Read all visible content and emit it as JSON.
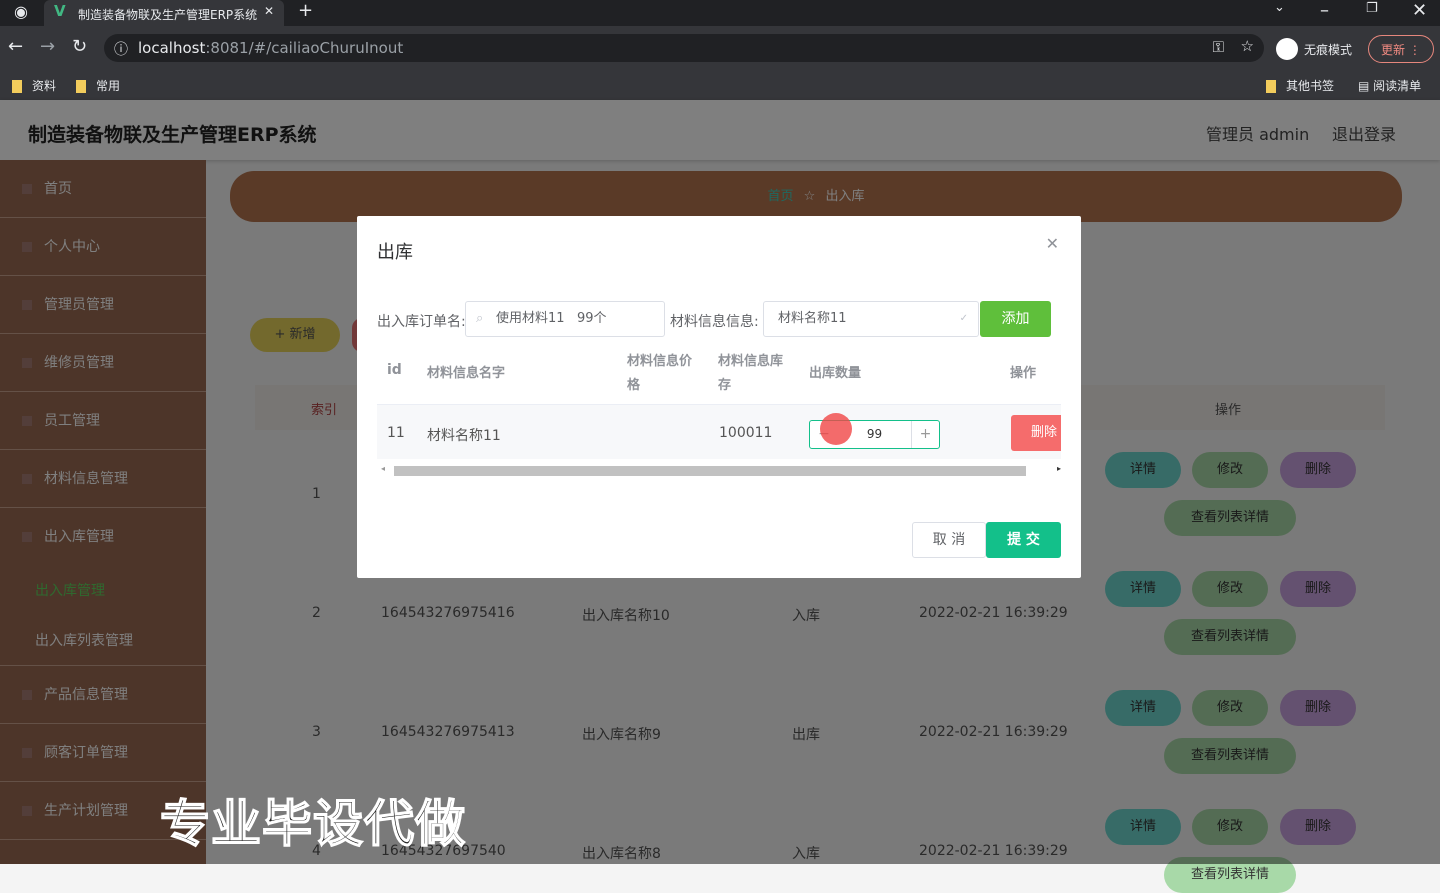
{
  "browser": {
    "tab_title": "制造装备物联及生产管理ERP系统",
    "url_host": "localhost",
    "url_path": ":8081/#/cailiaoChuruInout",
    "incognito": "无痕模式",
    "update": "更新",
    "bookmarks": [
      "资料",
      "常用"
    ],
    "other_bookmarks": "其他书签",
    "reading_list": "阅读清单"
  },
  "header": {
    "title": "制造装备物联及生产管理ERP系统",
    "user": "管理员 admin",
    "logout": "退出登录"
  },
  "sidebar": {
    "items": [
      "首页",
      "个人中心",
      "管理员管理",
      "维修员管理",
      "员工管理",
      "材料信息管理",
      "出入库管理"
    ],
    "sub_items": [
      "出入库管理",
      "出入库列表管理"
    ],
    "items_after": [
      "产品信息管理",
      "顾客订单管理",
      "生产计划管理"
    ]
  },
  "breadcrumb": {
    "home": "首页",
    "current": "出入库"
  },
  "toolbar": {
    "add": "+ 新增"
  },
  "table": {
    "headers": {
      "index": "索引",
      "ops": "操作"
    },
    "rows": [
      {
        "index": "1",
        "code": "",
        "name": "",
        "type": "",
        "time": ""
      },
      {
        "index": "2",
        "code": "164543276975416",
        "name": "出入库名称10",
        "type": "入库",
        "time": "2022-02-21 16:39:29"
      },
      {
        "index": "3",
        "code": "164543276975413",
        "name": "出入库名称9",
        "type": "出库",
        "time": "2022-02-21 16:39:29"
      },
      {
        "index": "4",
        "code": "16454327697540",
        "name": "出入库名称8",
        "type": "入库",
        "time": "2022-02-21 16:39:29"
      }
    ],
    "ops": {
      "detail": "详情",
      "edit": "修改",
      "delete": "删除",
      "list_detail": "查看列表详情"
    }
  },
  "modal": {
    "title": "出库",
    "order_label": "出入库订单名:",
    "order_value": "使用材料11   99个",
    "material_label": "材料信息信息:",
    "material_value": "材料名称11",
    "add": "添加",
    "headers": {
      "id": "id",
      "name": "材料信息名字",
      "price": "材料信息价格",
      "stock": "材料信息库存",
      "qty": "出库数量",
      "ops": "操作"
    },
    "row": {
      "id": "11",
      "name": "材料名称11",
      "price": "",
      "stock": "100011",
      "qty": "99",
      "delete": "删除"
    },
    "cancel": "取 消",
    "submit": "提 交"
  },
  "watermark": "专业毕设代做",
  "colors": {
    "sidebar": "#9a6a52",
    "crumb": "#b4744f",
    "submit": "#13c08a",
    "add": "#5fbf3b",
    "danger": "#f56c6c"
  }
}
